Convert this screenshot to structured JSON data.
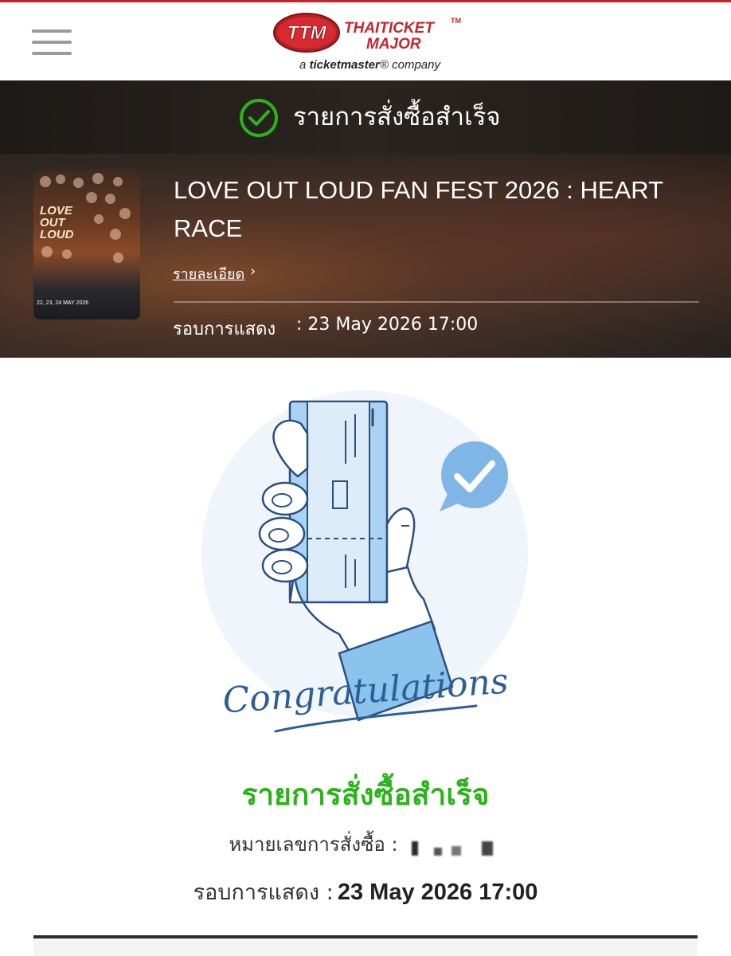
{
  "header": {
    "logo_name": "THAITICKET",
    "logo_major": "MAJOR",
    "logo_tm": "TM",
    "logo_sub_prefix": "a ",
    "logo_sub_brand": "ticketmaster",
    "logo_sub_suffix": "® company"
  },
  "status": {
    "text": "รายการสั่งซื้อสำเร็จ",
    "color": "#2bb31a"
  },
  "event": {
    "title": "LOVE OUT LOUD FAN FEST 2026 : HEART RACE",
    "detail_link": "รายละเอียด",
    "show_label": "รอบการแสดง",
    "show_value": ": 23 May 2026 17:00",
    "poster": {
      "title_lines": [
        "LOVE",
        "OUT",
        "LOUD"
      ],
      "date": "22, 23, 24 MAY 2026"
    }
  },
  "illustration": {
    "script_text": "Congratulations"
  },
  "confirmation": {
    "title": "รายการสั่งซื้อสำเร็จ",
    "order_label": "หมายเลขการสั่งซื้อ :",
    "show_label": "รอบการแสดง :",
    "show_value": "23 May 2026 17:00"
  },
  "colors": {
    "accent_green": "#2bb31a",
    "brand_red": "#c8232c",
    "illustration_blue": "#8cc3ec",
    "illustration_navy": "#2a4f80"
  }
}
